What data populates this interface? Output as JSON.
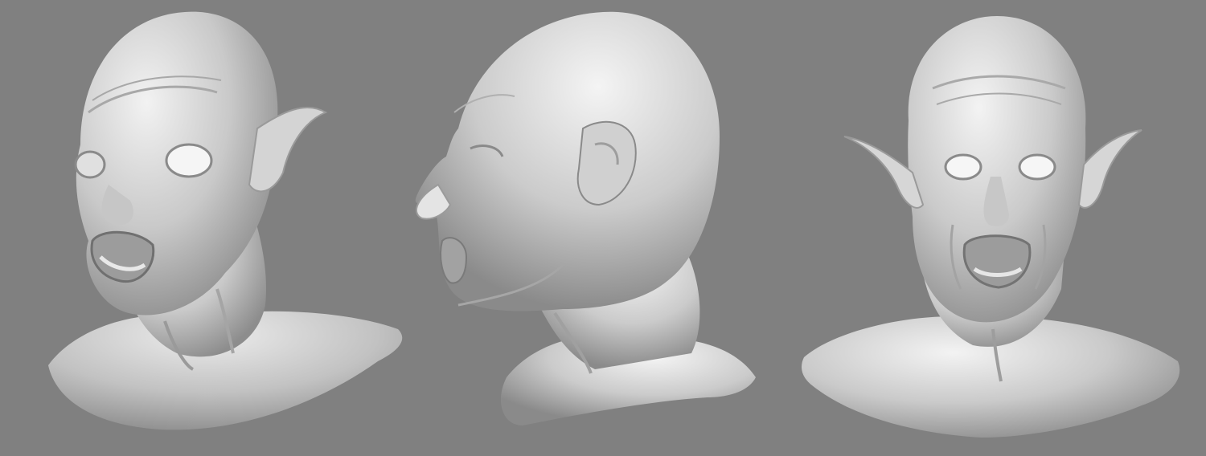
{
  "scene": {
    "background_color": "#808080",
    "material_color": "#d8d8d8",
    "shadow_color": "#6e6e6e",
    "views": [
      {
        "id": "three-quarter",
        "description_icon": "goblin-head-three-quarter"
      },
      {
        "id": "profile",
        "description_icon": "goblin-head-profile"
      },
      {
        "id": "front",
        "description_icon": "goblin-head-front"
      }
    ]
  }
}
